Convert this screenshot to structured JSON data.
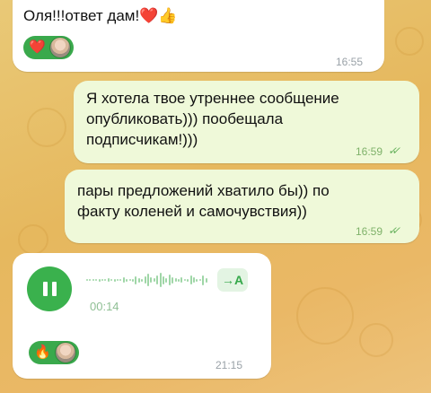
{
  "chat": {
    "msg1": {
      "text": "Оля!!!ответ дам!",
      "emoji": "❤️👍",
      "time": "16:55",
      "reaction": "❤️"
    },
    "msg2": {
      "line1": "Я хотела твое утреннее сообщение",
      "line2": "опубликовать))) пообещала",
      "line3": "подписчикам!)))",
      "time": "16:59",
      "status": "read"
    },
    "msg3": {
      "line1": "пары предложений хватило бы)) по",
      "line2": "факту коленей и самочувствия))",
      "time": "16:59",
      "status": "read"
    },
    "voice": {
      "duration": "00:14",
      "transcribe_label": "→A",
      "time": "21:15",
      "reaction": "🔥",
      "waveform": [
        2,
        2,
        2,
        2,
        3,
        2,
        2,
        4,
        2,
        3,
        2,
        2,
        6,
        3,
        2,
        3,
        9,
        5,
        3,
        8,
        14,
        6,
        4,
        10,
        16,
        9,
        5,
        12,
        7,
        4,
        3,
        6,
        2,
        3,
        10,
        6,
        3,
        2,
        11,
        5
      ]
    },
    "colors": {
      "accent": "#3aa94c",
      "outgoing_bubble": "#eff9d9",
      "incoming_bubble": "#ffffff",
      "wallpaper": "#e6b85e"
    },
    "icons": {
      "play_state": "pause-icon",
      "read_status": "double-check-icon"
    }
  }
}
